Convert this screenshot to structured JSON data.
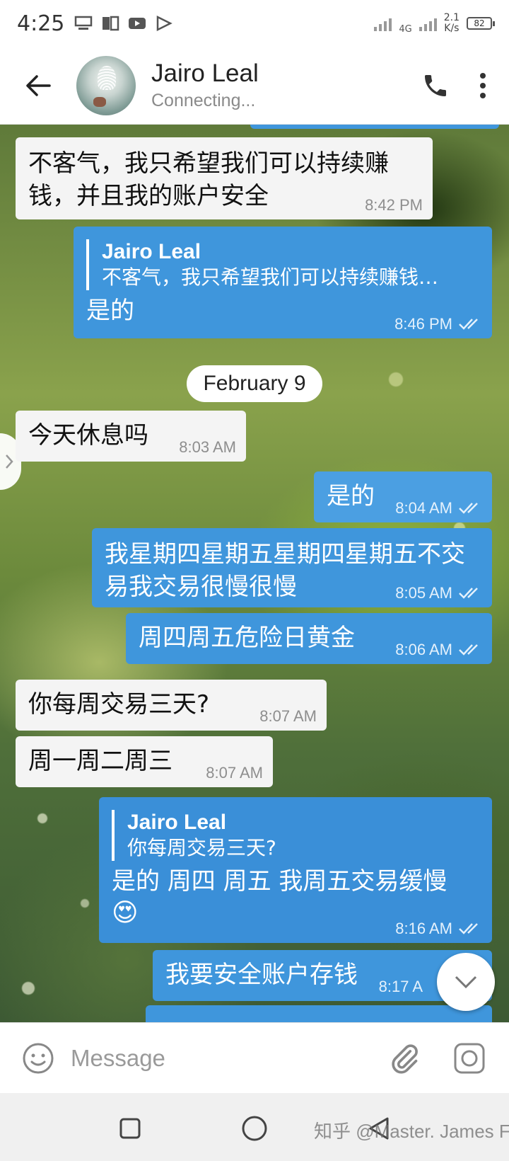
{
  "status_bar": {
    "time": "4:25",
    "network_type": "4G",
    "net_speed_value": "2.1",
    "net_speed_unit": "K/s",
    "battery": "82"
  },
  "header": {
    "name": "Jairo Leal",
    "status": "Connecting..."
  },
  "messages": [
    {
      "dir": "in",
      "text": "不客气，我只希望我们可以持续赚钱，并且我的账户安全",
      "time": "8:42 PM"
    },
    {
      "dir": "out",
      "reply_name": "Jairo Leal",
      "reply_text": "不客气，我只希望我们可以持续赚钱…",
      "text": "是的",
      "time": "8:46 PM"
    },
    {
      "dir": "in",
      "text": "今天休息吗",
      "time": "8:03 AM"
    },
    {
      "dir": "out",
      "text": "是的",
      "time": "8:04 AM"
    },
    {
      "dir": "out",
      "text": "我星期四星期五星期四星期五不交易我交易很慢很慢",
      "time": "8:05 AM"
    },
    {
      "dir": "out",
      "text": "周四周五危险日黄金",
      "time": "8:06 AM"
    },
    {
      "dir": "in",
      "text": "你每周交易三天?",
      "time": "8:07 AM"
    },
    {
      "dir": "in",
      "text": "周一周二周三",
      "time": "8:07 AM"
    },
    {
      "dir": "out",
      "reply_name": "Jairo Leal",
      "reply_text": "你每周交易三天?",
      "text": "是的 周四 周五 我周五交易缓慢",
      "emoji": "😍",
      "time": "8:16 AM"
    },
    {
      "dir": "out",
      "text": "我要安全账户存钱",
      "time": "8:17 A"
    }
  ],
  "date_separator": "February 9",
  "composer": {
    "placeholder": "Message"
  },
  "watermark": "知乎 @Master. James FX",
  "colors": {
    "outgoing_bubble": "#3f96dc",
    "incoming_bubble": "#f4f4f4",
    "read_check": "#e4f1fc"
  }
}
